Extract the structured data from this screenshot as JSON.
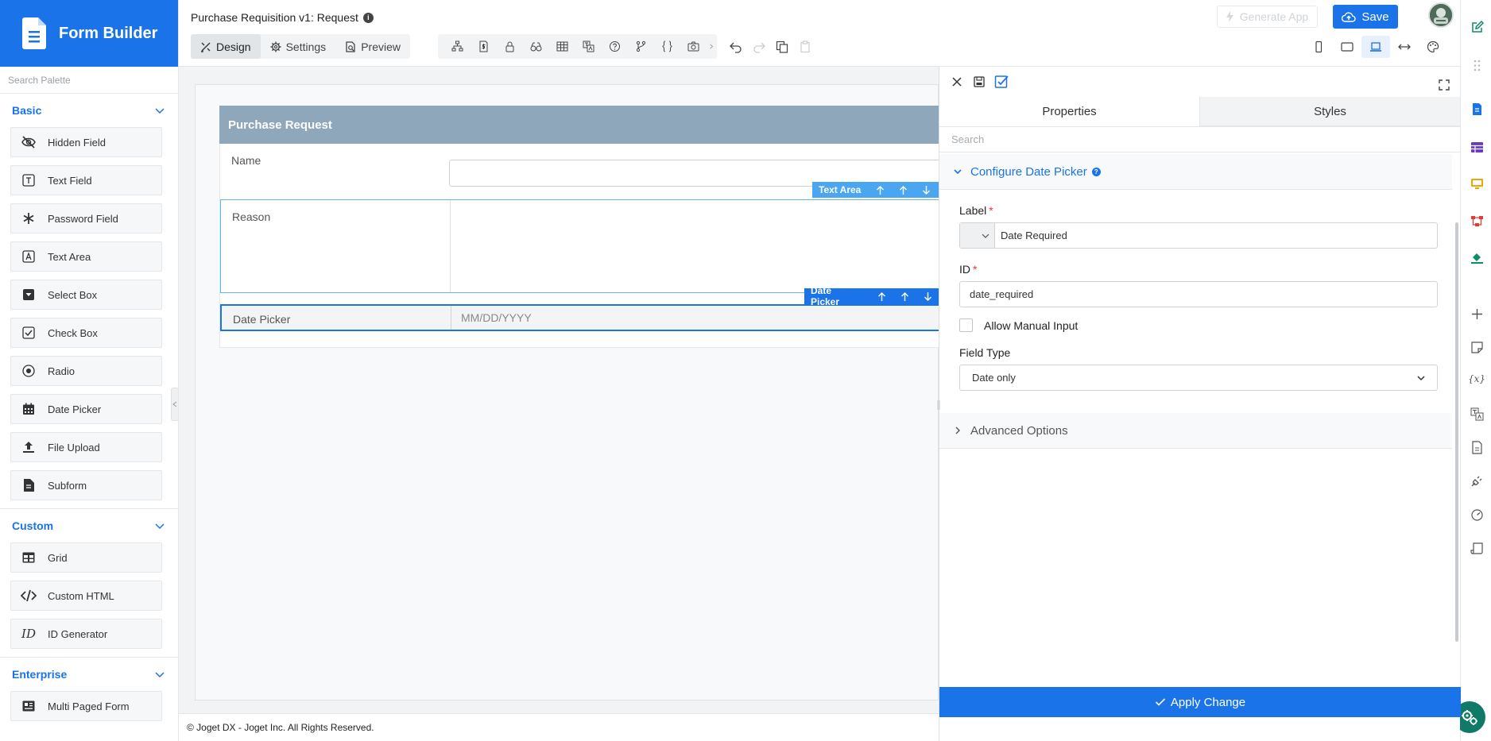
{
  "app": {
    "brand": "Form Builder"
  },
  "palette": {
    "search_placeholder": "Search Palette",
    "groups": [
      {
        "title": "Basic",
        "items": [
          {
            "label": "Hidden Field",
            "icon": "eye-slash-icon"
          },
          {
            "label": "Text Field",
            "icon": "text-field-icon"
          },
          {
            "label": "Password Field",
            "icon": "asterisk-icon"
          },
          {
            "label": "Text Area",
            "icon": "text-area-icon"
          },
          {
            "label": "Select Box",
            "icon": "select-box-icon"
          },
          {
            "label": "Check Box",
            "icon": "check-box-icon"
          },
          {
            "label": "Radio",
            "icon": "radio-icon"
          },
          {
            "label": "Date Picker",
            "icon": "calendar-icon"
          },
          {
            "label": "File Upload",
            "icon": "upload-icon"
          },
          {
            "label": "Subform",
            "icon": "subform-icon"
          }
        ]
      },
      {
        "title": "Custom",
        "items": [
          {
            "label": "Grid",
            "icon": "grid-icon"
          },
          {
            "label": "Custom HTML",
            "icon": "code-icon"
          },
          {
            "label": "ID Generator",
            "icon": "id-icon"
          }
        ]
      },
      {
        "title": "Enterprise",
        "items": [
          {
            "label": "Multi Paged Form",
            "icon": "newspaper-icon"
          }
        ]
      }
    ]
  },
  "header": {
    "doc_title": "Purchase Requisition v1: Request",
    "mode_tabs": [
      {
        "label": "Design",
        "active": true
      },
      {
        "label": "Settings",
        "active": false
      },
      {
        "label": "Preview",
        "active": false
      }
    ],
    "generate_app_label": "Generate App",
    "save_label": "Save"
  },
  "form": {
    "title": "Purchase Request",
    "fields": {
      "name_label": "Name",
      "reason_label": "Reason",
      "date_label": "Date Picker",
      "date_placeholder": "MM/DD/YYYY"
    },
    "toolbars": {
      "textarea_name": "Text Area",
      "datepicker_name": "Date Picker"
    }
  },
  "properties": {
    "tabs": [
      "Properties",
      "Styles"
    ],
    "search_placeholder": "Search",
    "section_title": "Configure Date Picker",
    "label_field": {
      "label": "Label",
      "value": "Date Required"
    },
    "id_field": {
      "label": "ID",
      "value": "date_required"
    },
    "manual_input_label": "Allow Manual Input",
    "field_type": {
      "label": "Field Type",
      "value": "Date only"
    },
    "advanced_title": "Advanced Options",
    "apply_label": "Apply Change"
  },
  "footer": {
    "text": "© Joget DX - Joget Inc. All Rights Reserved."
  },
  "colors": {
    "primary": "#1a73e8",
    "form_header": "#8fa7ba",
    "element_toolbar": "#4aa6f0",
    "chat_fab": "#0f7a68"
  }
}
